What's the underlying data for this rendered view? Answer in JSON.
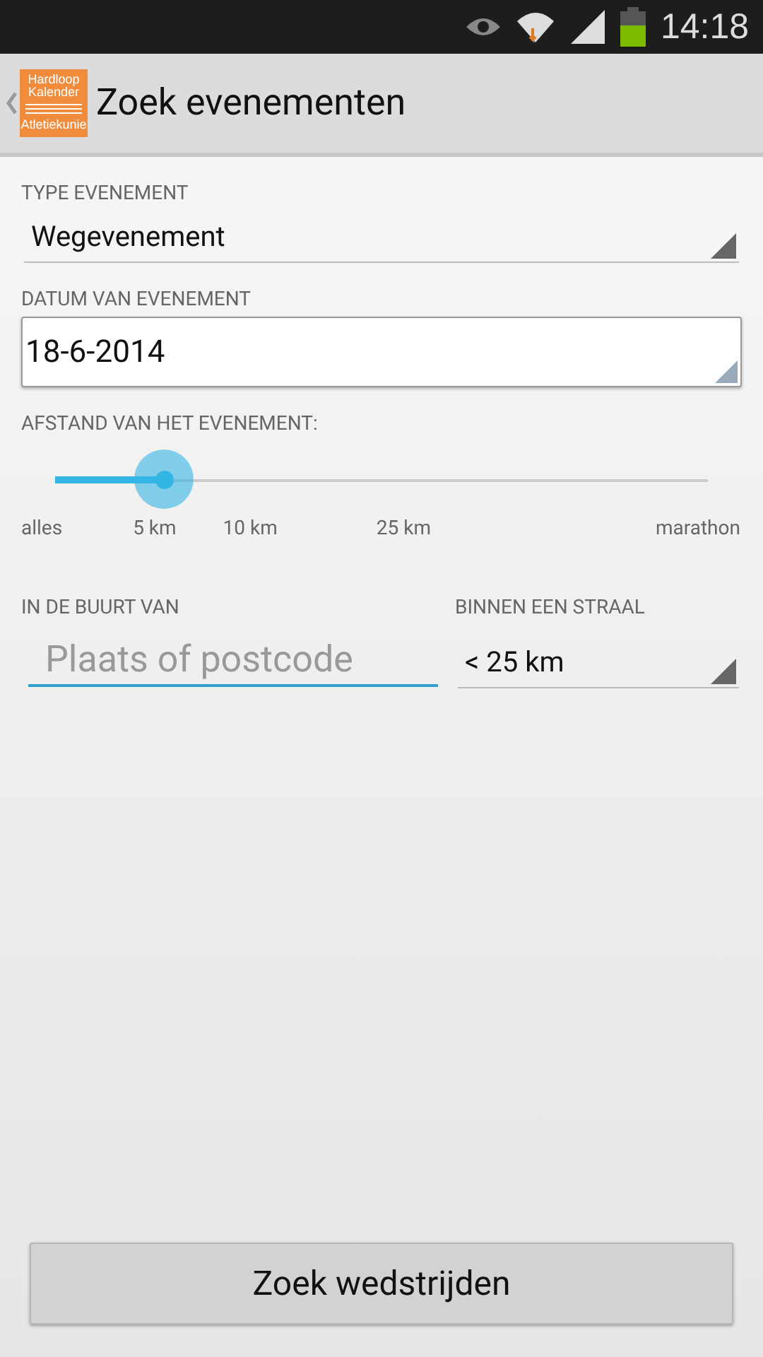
{
  "status_bar": {
    "time": "14:18",
    "battery": {
      "level": 0.6
    }
  },
  "action_bar": {
    "logo_lines": [
      "Hardloop",
      "Kalender",
      "Atletiekunie"
    ],
    "title": "Zoek evenementen"
  },
  "type_field": {
    "label": "TYPE EVENEMENT",
    "value": "Wegevenement"
  },
  "date_field": {
    "label": "DATUM VAN EVENEMENT",
    "value": "18-6-2014"
  },
  "distance": {
    "label": "AFSTAND VAN HET EVENEMENT:",
    "level": 0.167,
    "ticks": [
      "alles",
      "5 km",
      "10 km",
      "25 km",
      "marathon"
    ]
  },
  "near_field": {
    "label": "IN DE BUURT VAN",
    "placeholder": "Plaats of postcode"
  },
  "radius_field": {
    "label": "BINNEN EEN STRAAL",
    "value": "< 25 km"
  },
  "search_button": {
    "label": "Zoek wedstrijden"
  }
}
